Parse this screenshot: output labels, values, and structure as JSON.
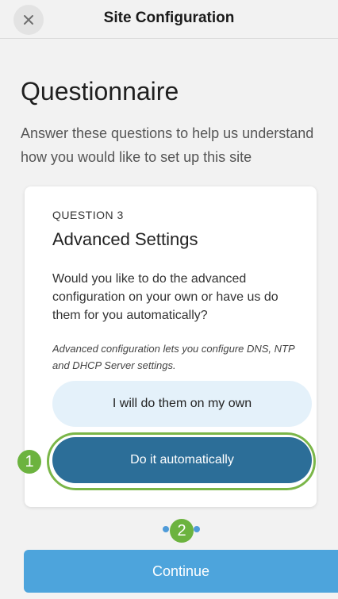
{
  "header": {
    "title": "Site Configuration",
    "close_icon": "close-icon"
  },
  "intro": {
    "heading": "Questionnaire",
    "subtitle": "Answer these questions to help us understand how you would like to set up this site"
  },
  "question": {
    "number": "QUESTION 3",
    "title": "Advanced Settings",
    "body": "Would you like to do the advanced configuration on your own or have us do them for you automatically?",
    "note": "Advanced configuration lets you configure DNS, NTP and DHCP Server settings.",
    "options": [
      {
        "label": "I will do them on my own",
        "selected": false
      },
      {
        "label": "Do it automatically",
        "selected": true
      }
    ]
  },
  "callouts": [
    "1",
    "2"
  ],
  "footer": {
    "continue_label": "Continue"
  },
  "colors": {
    "accent": "#2c6e98",
    "continue": "#4da4dc",
    "callout": "#6cb33f"
  }
}
